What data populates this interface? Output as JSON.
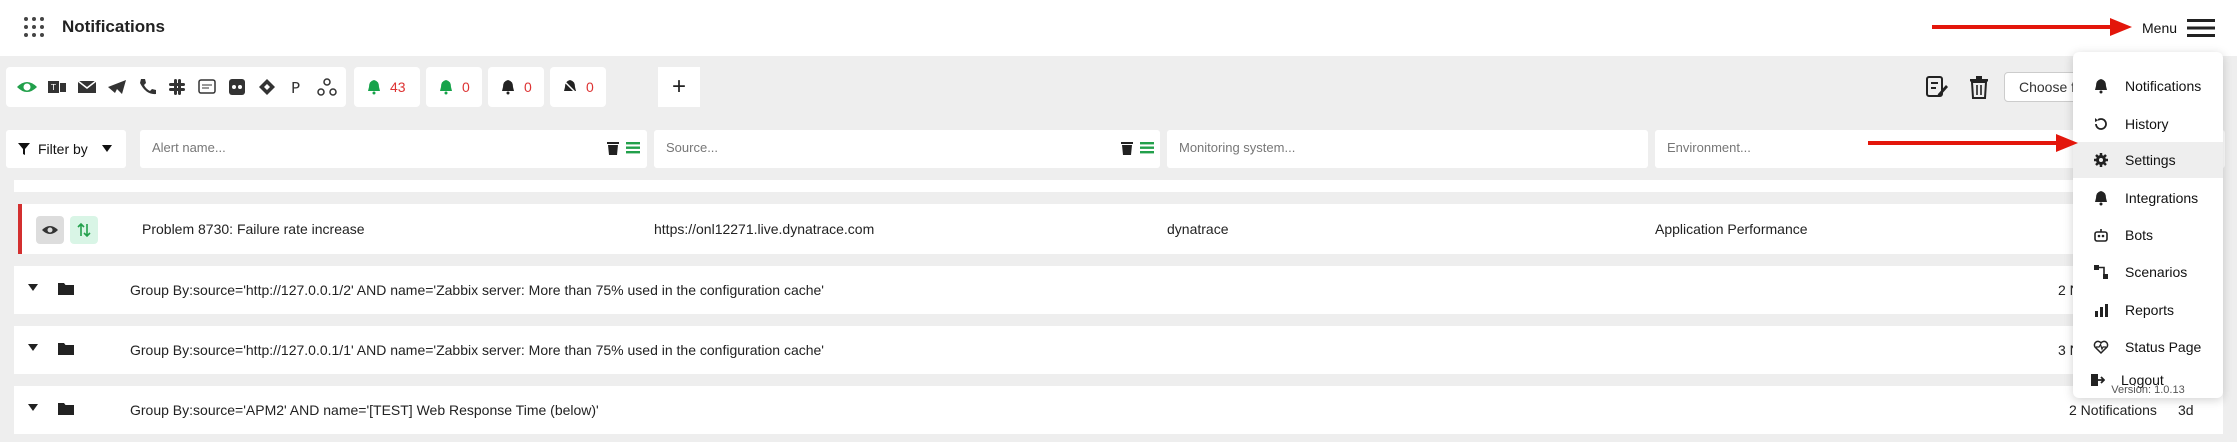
{
  "header": {
    "title": "Notifications",
    "menu_label": "Menu"
  },
  "toolbar": {
    "channels": [
      "eye-icon",
      "teams-icon",
      "mail-icon",
      "telegram-icon",
      "phone-icon",
      "slack-icon",
      "sms-icon",
      "rocketchat-icon",
      "jira-icon",
      "pushover-icon",
      "webhook-icon"
    ],
    "counters": [
      {
        "name": "active",
        "value": "43",
        "color": "#16a34a"
      },
      {
        "name": "acknowledged",
        "value": "0",
        "color": "#16a34a"
      },
      {
        "name": "snoozed",
        "value": "0",
        "color": "#222222"
      },
      {
        "name": "muted",
        "value": "0",
        "color": "#222222"
      }
    ],
    "add_label": "+",
    "choose_label": "Choose f"
  },
  "filters": {
    "filter_by_label": "Filter by",
    "alert_placeholder": "Alert name...",
    "source_placeholder": "Source...",
    "monitoring_placeholder": "Monitoring system...",
    "environment_placeholder": "Environment...",
    "hidden_count": "0"
  },
  "alert": {
    "name": "Problem 8730: Failure rate increase",
    "source": "https://onl12271.live.dynatrace.com",
    "monitoring": "dynatrace",
    "environment": "Application Performance"
  },
  "groups": [
    {
      "text": "Group By:source='http://127.0.0.1/2' AND name='Zabbix server: More than 75% used in the configuration cache'",
      "count": "2 N"
    },
    {
      "text": "Group By:source='http://127.0.0.1/1' AND name='Zabbix server: More than 75% used in the configuration cache'",
      "count": "3 N"
    },
    {
      "text": "Group By:source='APM2' AND name='[TEST] Web Response Time (below)'",
      "count": "2 Notifications",
      "age": "3d"
    }
  ],
  "menu": {
    "items": [
      {
        "label": "Notifications",
        "icon": "bell-icon"
      },
      {
        "label": "History",
        "icon": "history-icon"
      },
      {
        "label": "Settings",
        "icon": "gear-icon"
      },
      {
        "label": "Integrations",
        "icon": "bell-icon"
      },
      {
        "label": "Bots",
        "icon": "robot-icon"
      },
      {
        "label": "Scenarios",
        "icon": "scenario-icon"
      },
      {
        "label": "Reports",
        "icon": "chart-icon"
      },
      {
        "label": "Status Page",
        "icon": "heartbeat-icon"
      },
      {
        "label": "Logout",
        "icon": "logout-icon"
      }
    ],
    "version": "Version: 1.0.13"
  },
  "colors": {
    "accent_red": "#d32f2f",
    "arrow_red": "#e3160b",
    "green": "#22a04b"
  }
}
